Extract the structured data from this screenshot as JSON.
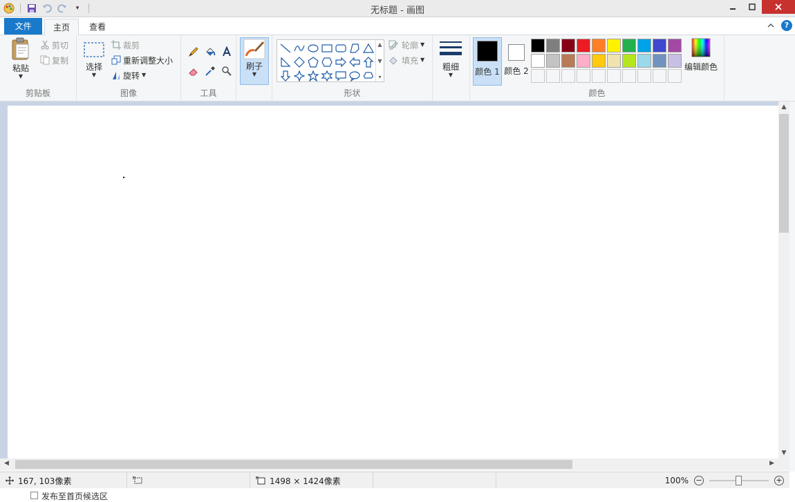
{
  "window": {
    "title": "无标题 - 画图"
  },
  "tabs": [
    {
      "label": "文件"
    },
    {
      "label": "主页"
    },
    {
      "label": "查看"
    }
  ],
  "ribbon": {
    "clipboard": {
      "label": "剪贴板",
      "paste": "粘贴",
      "cut": "剪切",
      "copy": "复制"
    },
    "image": {
      "label": "图像",
      "select": "选择",
      "crop": "裁剪",
      "resize": "重新调整大小",
      "rotate": "旋转"
    },
    "tools": {
      "label": "工具"
    },
    "brushes": {
      "label": "刷子"
    },
    "shapes": {
      "label": "形状",
      "outline": "轮廓",
      "fill": "填充"
    },
    "size": {
      "label": "粗细"
    },
    "colors": {
      "label": "颜色",
      "color1": "颜色 1",
      "color2": "颜色 2",
      "edit": "编辑颜色",
      "color1_value": "#000000",
      "color2_value": "#ffffff",
      "palette": [
        "#000000",
        "#7f7f7f",
        "#880015",
        "#ed1c24",
        "#ff7f27",
        "#fff200",
        "#22b14c",
        "#00a2e8",
        "#3f48cc",
        "#a349a4",
        "#ffffff",
        "#c3c3c3",
        "#b97a57",
        "#ffaec9",
        "#ffc90e",
        "#efe4b0",
        "#b5e61d",
        "#99d9ea",
        "#7092be",
        "#c8bfe7"
      ],
      "custom_slots": 10
    }
  },
  "status": {
    "cursor_pos": "167, 103像素",
    "canvas_size": "1498 × 1424像素",
    "zoom": "100%"
  },
  "bottom": {
    "checkbox_label": "发布至首页候选区"
  }
}
